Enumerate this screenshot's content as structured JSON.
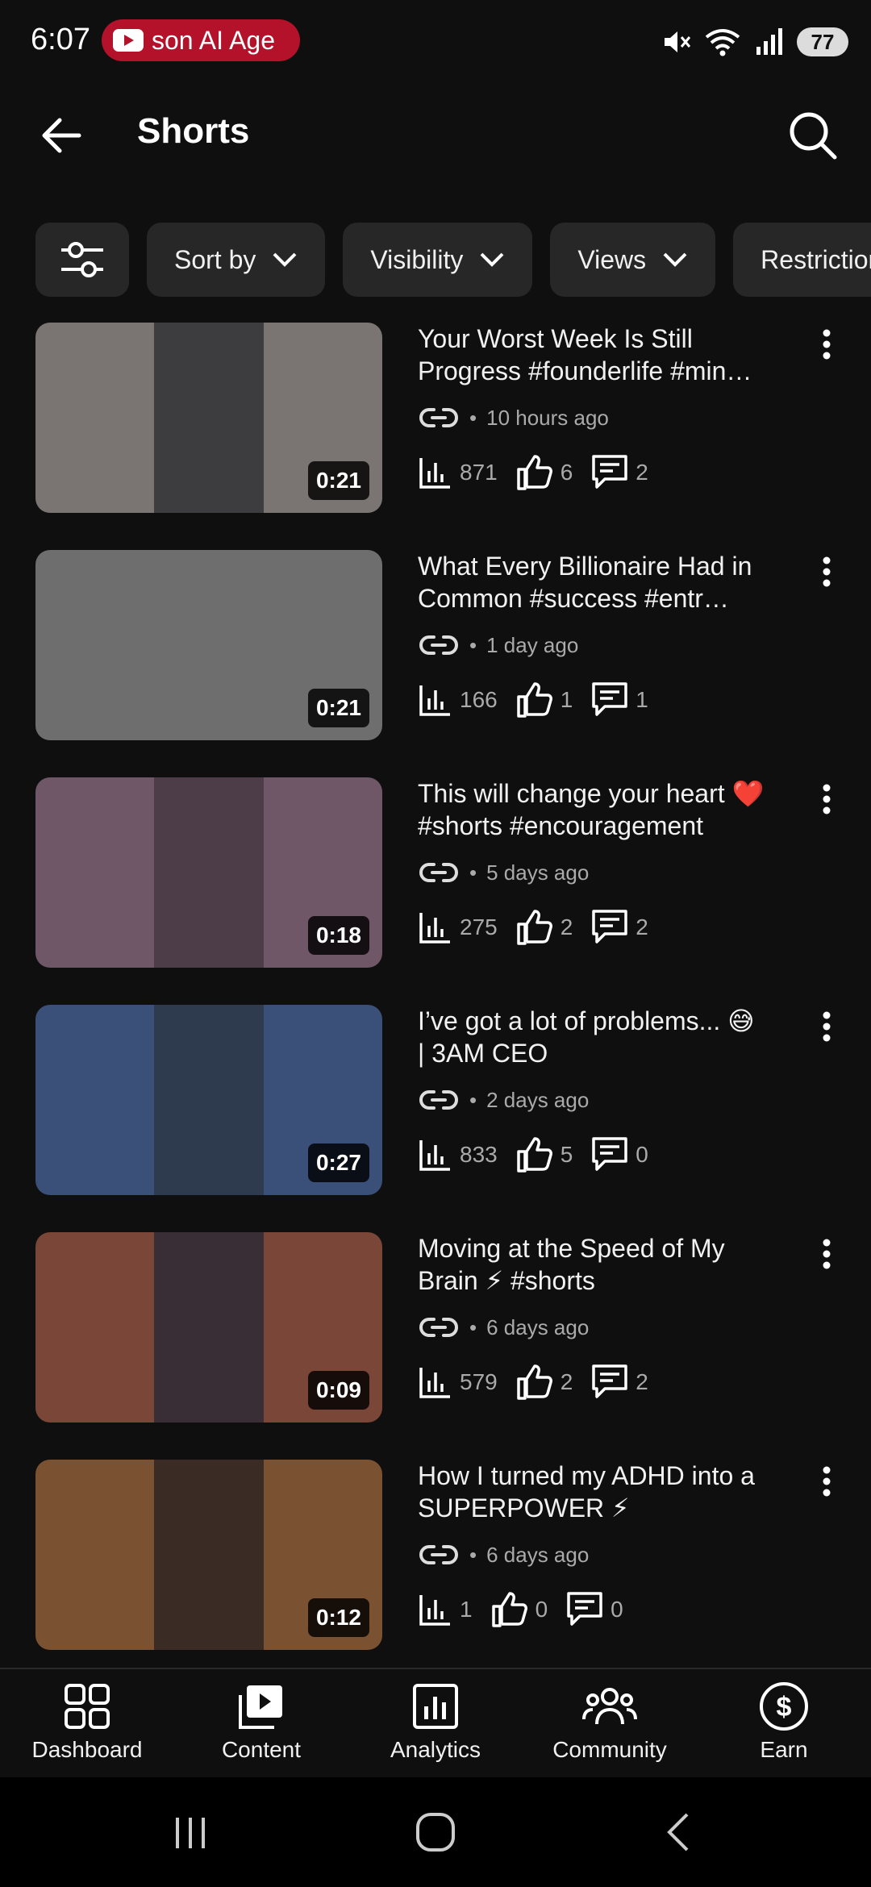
{
  "status": {
    "time": "6:07",
    "pill_text": "son AI Age",
    "battery": "77"
  },
  "header": {
    "title": "Shorts"
  },
  "chips": [
    {
      "label": "Sort by"
    },
    {
      "label": "Visibility"
    },
    {
      "label": "Views"
    },
    {
      "label": "Restriction"
    }
  ],
  "videos": [
    {
      "title": "Your Worst Week Is Still Progress #founderlife #min…",
      "age": "10 hours ago",
      "views": "871",
      "likes": "6",
      "comments": "2",
      "duration": "0:21",
      "thumb_bg": "#7a7572",
      "thumb_center": "#3d3c3e"
    },
    {
      "title": "What Every Billionaire Had in Common #success #entr…",
      "age": "1 day ago",
      "views": "166",
      "likes": "1",
      "comments": "1",
      "duration": "0:21",
      "thumb_bg": "#6e6e6e",
      "thumb_center": "#6e6e6e"
    },
    {
      "title": "This will change your heart ❤️ #shorts #encouragement",
      "age": "5 days ago",
      "views": "275",
      "likes": "2",
      "comments": "2",
      "duration": "0:18",
      "thumb_bg": "#6f5768",
      "thumb_center": "#4c3d48"
    },
    {
      "title": "I’ve got a lot of problems... 😅 | 3AM CEO",
      "age": "2 days ago",
      "views": "833",
      "likes": "5",
      "comments": "0",
      "duration": "0:27",
      "thumb_bg": "#3b5078",
      "thumb_center": "#2e3a4e"
    },
    {
      "title": "Moving at the Speed of My Brain ⚡ #shorts",
      "age": "6 days ago",
      "views": "579",
      "likes": "2",
      "comments": "2",
      "duration": "0:09",
      "thumb_bg": "#7a4638",
      "thumb_center": "#3a2e36"
    },
    {
      "title": "How I turned my ADHD into a SUPERPOWER ⚡",
      "age": "6 days ago",
      "views": "1",
      "likes": "0",
      "comments": "0",
      "duration": "0:12",
      "thumb_bg": "#7a5232",
      "thumb_center": "#3a2b24"
    }
  ],
  "bottom_nav": [
    {
      "label": "Dashboard",
      "icon": "dashboard-icon"
    },
    {
      "label": "Content",
      "icon": "content-icon"
    },
    {
      "label": "Analytics",
      "icon": "analytics-icon"
    },
    {
      "label": "Community",
      "icon": "community-icon"
    },
    {
      "label": "Earn",
      "icon": "earn-icon"
    }
  ],
  "colors": {
    "background": "#0f0f0f",
    "chip": "#272727",
    "pill": "#b3122a"
  }
}
